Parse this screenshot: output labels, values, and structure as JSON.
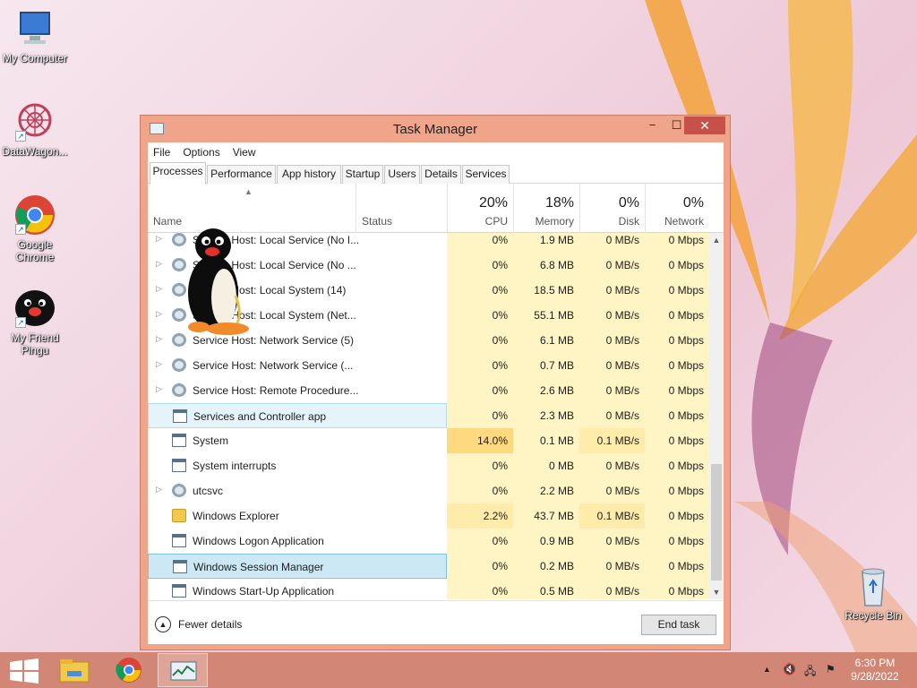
{
  "desktop": {
    "icons": [
      {
        "label": "My Computer",
        "icon": "computer-icon"
      },
      {
        "label": "DataWagon...",
        "icon": "datawagon-icon"
      },
      {
        "label": "Google Chrome",
        "icon": "chrome-icon"
      },
      {
        "label": "My Friend Pingu",
        "icon": "pingu-icon"
      },
      {
        "label": "Recycle Bin",
        "icon": "recycle-bin-icon"
      }
    ]
  },
  "window": {
    "title": "Task Manager",
    "controls": {
      "minimize": "−",
      "maximize": "☐",
      "close": "✕"
    },
    "menu": [
      "File",
      "Options",
      "View"
    ],
    "tabs": [
      "Processes",
      "Performance",
      "App history",
      "Startup",
      "Users",
      "Details",
      "Services"
    ],
    "active_tab": "Processes",
    "columns": {
      "name": "Name",
      "status": "Status",
      "cpu": {
        "pct": "20%",
        "label": "CPU"
      },
      "memory": {
        "pct": "18%",
        "label": "Memory"
      },
      "disk": {
        "pct": "0%",
        "label": "Disk"
      },
      "network": {
        "pct": "0%",
        "label": "Network"
      }
    },
    "rows": [
      {
        "name": "Service Host: Local Service (No I...",
        "expandable": true,
        "icon": "gear-icon",
        "cpu": "0%",
        "memory": "1.9 MB",
        "disk": "0 MB/s",
        "network": "0 Mbps"
      },
      {
        "name": "Service Host: Local Service (No ...",
        "expandable": true,
        "icon": "gear-icon",
        "cpu": "0%",
        "memory": "6.8 MB",
        "disk": "0 MB/s",
        "network": "0 Mbps"
      },
      {
        "name": "Service Host: Local System (14)",
        "expandable": true,
        "icon": "gear-icon",
        "cpu": "0%",
        "memory": "18.5 MB",
        "disk": "0 MB/s",
        "network": "0 Mbps"
      },
      {
        "name": "Service Host: Local System (Net...",
        "expandable": true,
        "icon": "gear-icon",
        "cpu": "0%",
        "memory": "55.1 MB",
        "disk": "0 MB/s",
        "network": "0 Mbps"
      },
      {
        "name": "Service Host: Network Service (5)",
        "expandable": true,
        "icon": "gear-icon",
        "cpu": "0%",
        "memory": "6.1 MB",
        "disk": "0 MB/s",
        "network": "0 Mbps"
      },
      {
        "name": "Service Host: Network Service (...",
        "expandable": true,
        "icon": "gear-icon",
        "cpu": "0%",
        "memory": "0.7 MB",
        "disk": "0 MB/s",
        "network": "0 Mbps"
      },
      {
        "name": "Service Host: Remote Procedure...",
        "expandable": true,
        "icon": "gear-icon",
        "cpu": "0%",
        "memory": "2.6 MB",
        "disk": "0 MB/s",
        "network": "0 Mbps"
      },
      {
        "name": "Services and Controller app",
        "expandable": false,
        "icon": "window-icon",
        "cpu": "0%",
        "memory": "2.3 MB",
        "disk": "0 MB/s",
        "network": "0 Mbps",
        "state": "hover"
      },
      {
        "name": "System",
        "expandable": false,
        "icon": "window-icon",
        "cpu": "14.0%",
        "memory": "0.1 MB",
        "disk": "0.1 MB/s",
        "network": "0 Mbps",
        "cpu_heat": 2,
        "disk_heat": 1
      },
      {
        "name": "System interrupts",
        "expandable": false,
        "icon": "window-icon",
        "cpu": "0%",
        "memory": "0 MB",
        "disk": "0 MB/s",
        "network": "0 Mbps"
      },
      {
        "name": "utcsvc",
        "expandable": true,
        "icon": "gear-icon",
        "cpu": "0%",
        "memory": "2.2 MB",
        "disk": "0 MB/s",
        "network": "0 Mbps"
      },
      {
        "name": "Windows Explorer",
        "expandable": false,
        "icon": "folder-icon",
        "cpu": "2.2%",
        "memory": "43.7 MB",
        "disk": "0.1 MB/s",
        "network": "0 Mbps",
        "cpu_heat": 1,
        "disk_heat": 1
      },
      {
        "name": "Windows Logon Application",
        "expandable": false,
        "icon": "window-icon",
        "cpu": "0%",
        "memory": "0.9 MB",
        "disk": "0 MB/s",
        "network": "0 Mbps"
      },
      {
        "name": "Windows Session Manager",
        "expandable": false,
        "icon": "window-icon",
        "cpu": "0%",
        "memory": "0.2 MB",
        "disk": "0 MB/s",
        "network": "0 Mbps",
        "state": "selected"
      },
      {
        "name": "Windows Start-Up Application",
        "expandable": false,
        "icon": "window-icon",
        "cpu": "0%",
        "memory": "0.5 MB",
        "disk": "0 MB/s",
        "network": "0 Mbps"
      }
    ],
    "footer": {
      "fewer_details": "Fewer details",
      "end_task": "End task"
    }
  },
  "taskbar": {
    "buttons": [
      "start-icon",
      "file-explorer-icon",
      "chrome-icon",
      "task-manager-icon"
    ],
    "clock": {
      "time": "6:30 PM",
      "date": "9/28/2022"
    }
  },
  "colors": {
    "window_frame": "#f0a58a",
    "close_button": "#c7504a",
    "selection": "#cce8f4",
    "heat_low": "#fff4c4",
    "heat_high": "#ffd980"
  }
}
